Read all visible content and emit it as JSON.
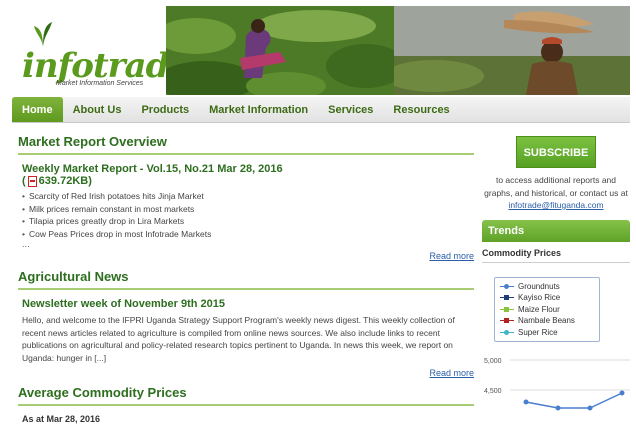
{
  "header": {
    "logo_text": "infotrade",
    "logo_tagline": "Market Information Services"
  },
  "nav": {
    "items": [
      "Home",
      "About Us",
      "Products",
      "Market Information",
      "Services",
      "Resources"
    ],
    "active": "Home"
  },
  "market_report": {
    "section_title": "Market Report Overview",
    "report_title": "Weekly Market Report - Vol.15, No.21 Mar 28, 2016",
    "file_size": "639.72KB",
    "bullets": [
      "Scarcity of Red Irish potatoes hits Jinja Market",
      "Milk prices remain constant in most markets",
      "Tilapia prices greatly drop in Lira Markets",
      "Cow Peas Prices drop in most Infotrade Markets"
    ],
    "ellipsis": "...",
    "read_more": "Read more"
  },
  "agri_news": {
    "section_title": "Agricultural News",
    "news_title": "Newsletter week of November 9th 2015",
    "body": "Hello, and welcome to the IFPRI Uganda Strategy Support Program's weekly news digest. This weekly collection of recent news articles related to agriculture is compiled from online news sources. We also include links to recent publications on agricultural and policy-related research topics pertinent to Uganda. In news this week, we report on Uganda: hunger in [...]",
    "read_more": "Read more"
  },
  "avg_prices": {
    "section_title": "Average Commodity Prices",
    "as_at": "As at Mar 28, 2016"
  },
  "sidebar": {
    "subscribe_label": "SUBSCRIBE",
    "subscribe_text": "to access additional reports and graphs, and historical, or contact us at",
    "contact_email": "infotrade@fituganda.com",
    "trends_title": "Trends",
    "commodity_prices_label": "Commodity Prices"
  },
  "chart_data": {
    "type": "line",
    "series": [
      {
        "name": "Groundnuts",
        "color": "#4a7fd0",
        "marker": "circle"
      },
      {
        "name": "Kayiso Rice",
        "color": "#1f3f7a",
        "marker": "diamond"
      },
      {
        "name": "Maize Flour",
        "color": "#8ac43a",
        "marker": "triangle"
      },
      {
        "name": "Nambale Beans",
        "color": "#b0231f",
        "marker": "square"
      },
      {
        "name": "Super Rice",
        "color": "#3fb6c6",
        "marker": "circle"
      }
    ],
    "yticks": [
      "5,000",
      "4,500"
    ],
    "visible_line": {
      "series": "Groundnuts",
      "values": [
        4300,
        4200,
        4200,
        4450
      ]
    },
    "ylim": [
      4000,
      5000
    ]
  }
}
